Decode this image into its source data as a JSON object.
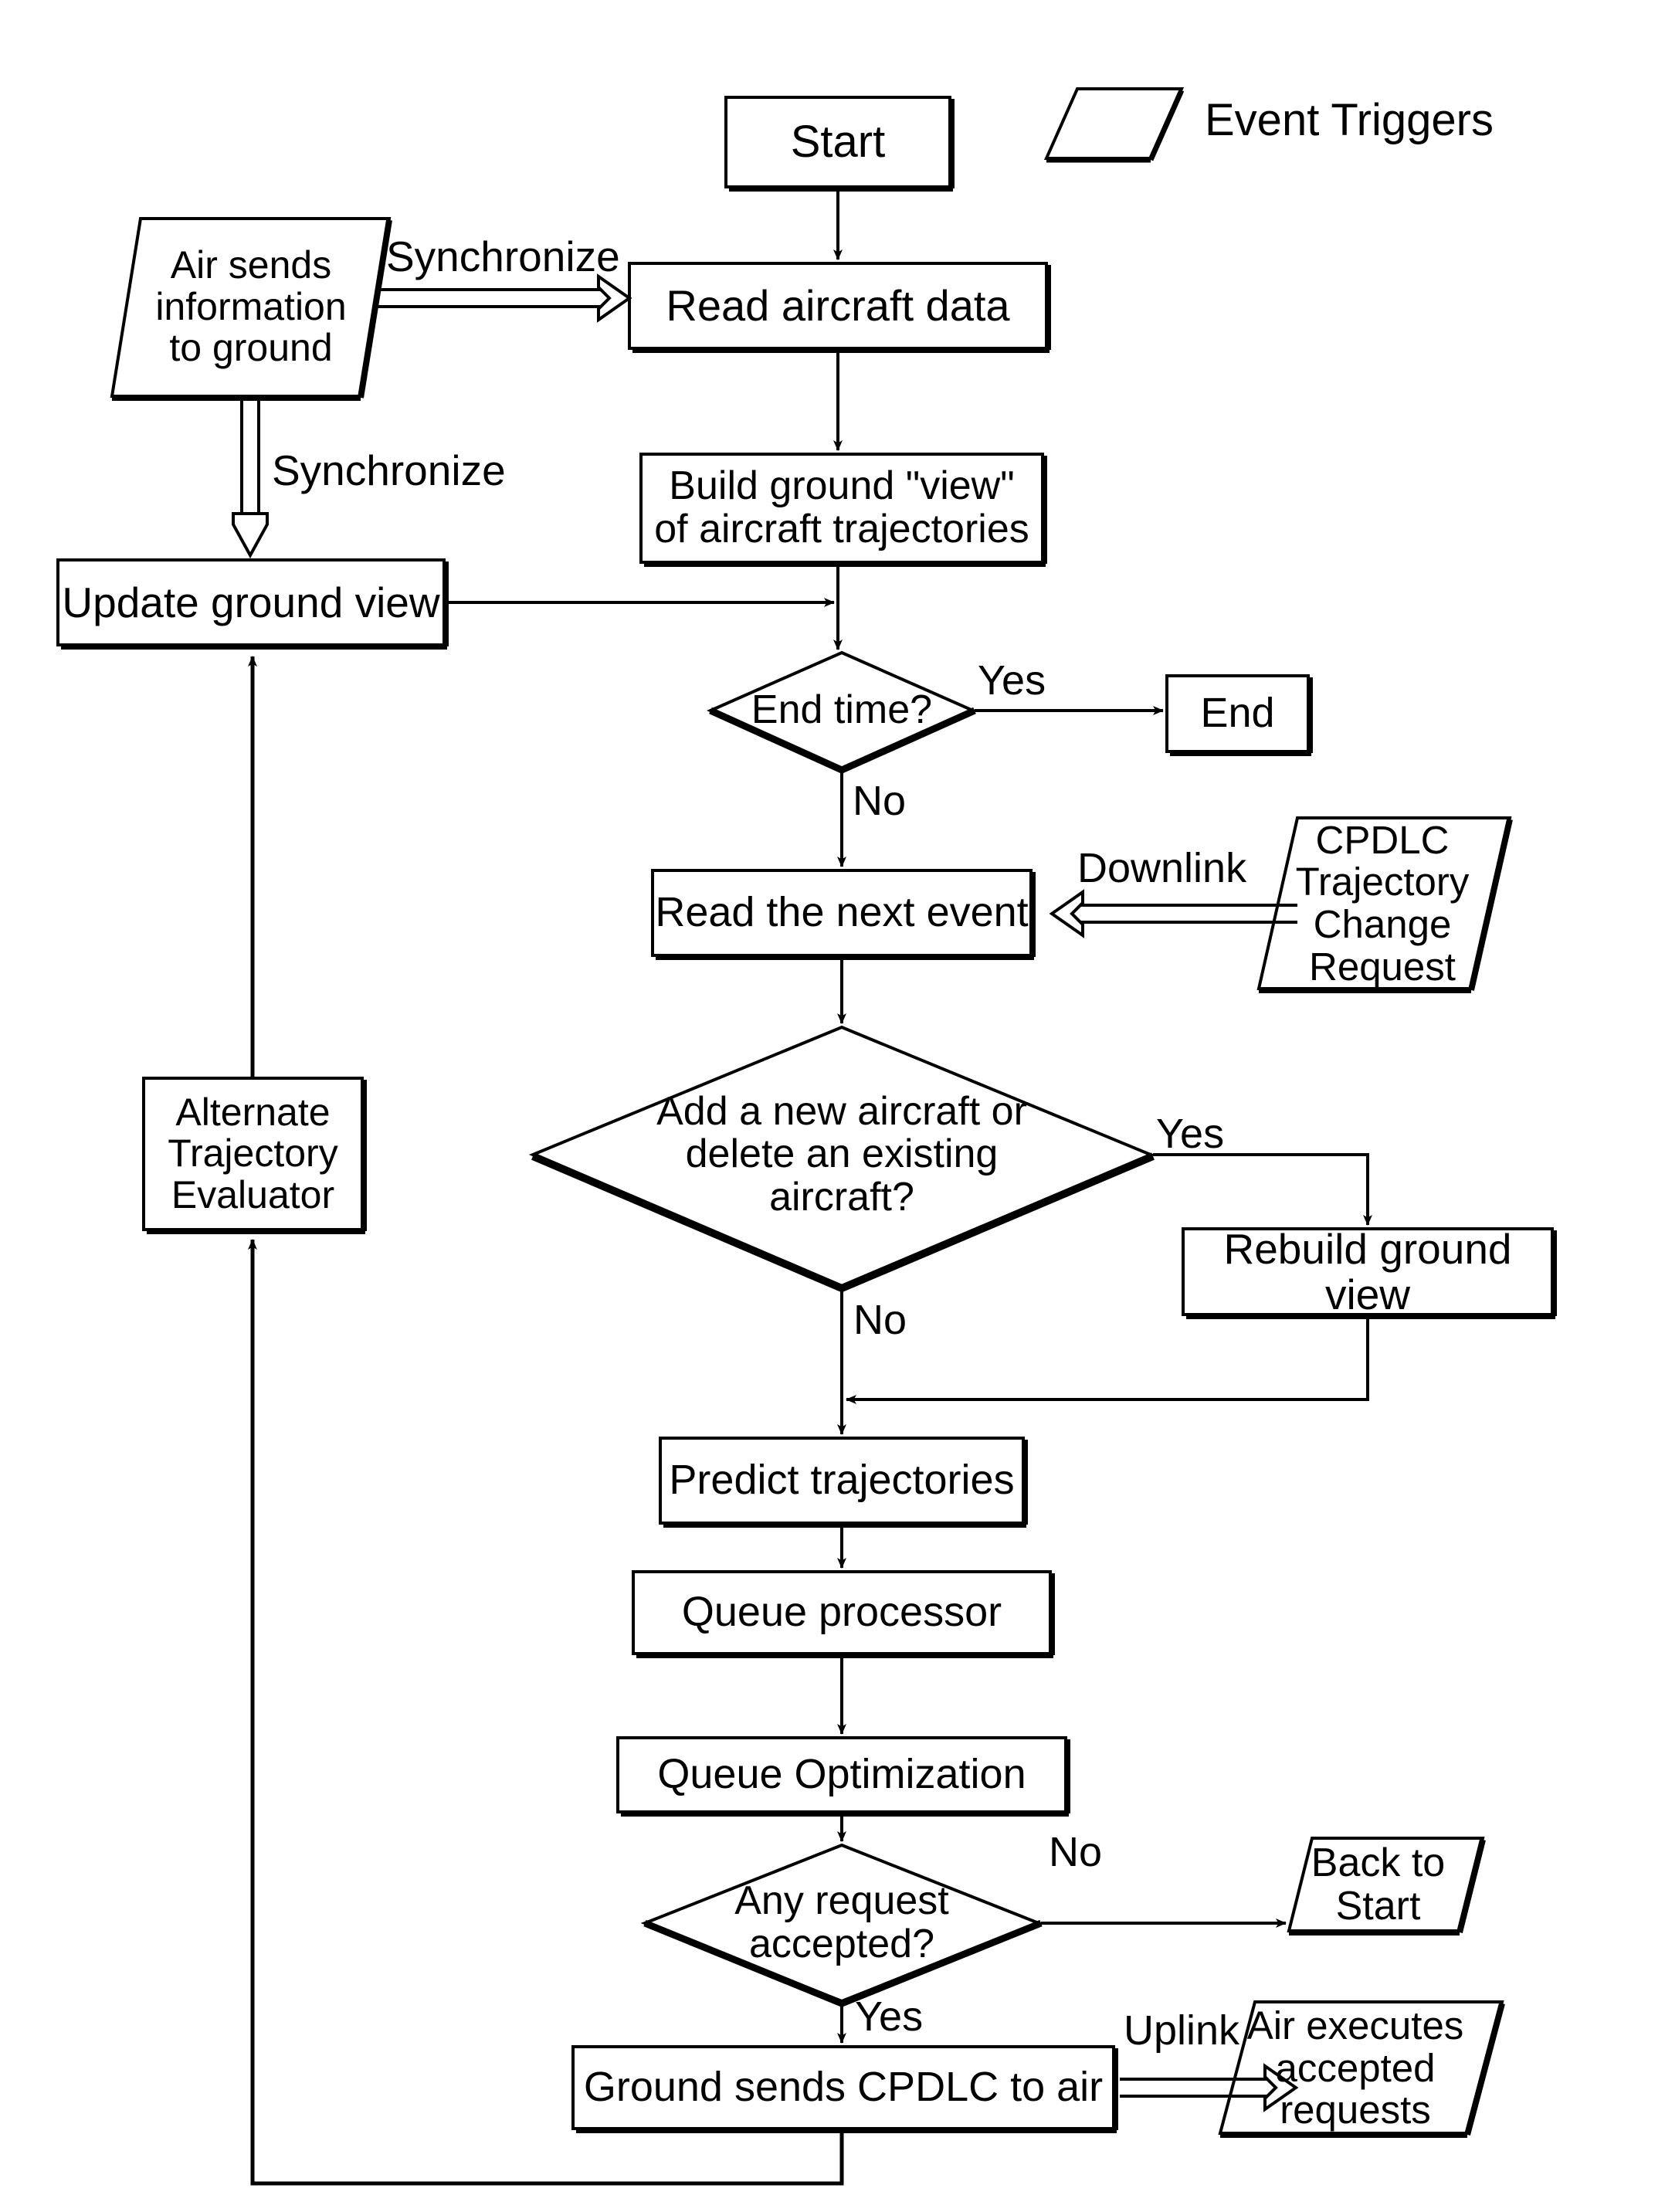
{
  "diagram": {
    "title": "Ground automation CPDLC trajectory processing flowchart",
    "legend": {
      "shape": "parallelogram",
      "label": "Event Triggers"
    },
    "colors": {
      "stroke": "#000000",
      "fill": "#ffffff",
      "text": "#000000"
    },
    "nodes": [
      {
        "id": "start",
        "shape": "process",
        "label": "Start"
      },
      {
        "id": "air_sends",
        "shape": "parallelogram",
        "label": "Air sends\ninformation\nto ground"
      },
      {
        "id": "read_data",
        "shape": "process",
        "label": "Read aircraft data"
      },
      {
        "id": "build_view",
        "shape": "process",
        "label": "Build ground \"view\"\nof aircraft trajectories"
      },
      {
        "id": "update_view",
        "shape": "process",
        "label": "Update ground view"
      },
      {
        "id": "end_time",
        "shape": "decision",
        "label": "End time?"
      },
      {
        "id": "end",
        "shape": "process",
        "label": "End"
      },
      {
        "id": "read_event",
        "shape": "process",
        "label": "Read the next event"
      },
      {
        "id": "cpdlc_req",
        "shape": "parallelogram",
        "label": "CPDLC\nTrajectory\nChange\nRequest"
      },
      {
        "id": "add_delete",
        "shape": "decision",
        "label": "Add a new aircraft or\ndelete an existing aircraft?"
      },
      {
        "id": "rebuild_view",
        "shape": "process",
        "label": "Rebuild ground view"
      },
      {
        "id": "alt_traj",
        "shape": "process",
        "label": "Alternate\nTrajectory\nEvaluator"
      },
      {
        "id": "predict",
        "shape": "process",
        "label": "Predict trajectories"
      },
      {
        "id": "queue_proc",
        "shape": "process",
        "label": "Queue processor"
      },
      {
        "id": "queue_opt",
        "shape": "process",
        "label": "Queue Optimization"
      },
      {
        "id": "any_req",
        "shape": "decision",
        "label": "Any request\naccepted?"
      },
      {
        "id": "back_start",
        "shape": "parallelogram",
        "label": "Back to\nStart"
      },
      {
        "id": "ground_sends",
        "shape": "process",
        "label": "Ground sends CPDLC to air"
      },
      {
        "id": "air_exec",
        "shape": "parallelogram",
        "label": "Air executes\naccepted\nrequests"
      }
    ],
    "edge_labels": [
      {
        "id": "sync_right",
        "text": "Synchronize"
      },
      {
        "id": "sync_down",
        "text": "Synchronize"
      },
      {
        "id": "yes_endtime",
        "text": "Yes"
      },
      {
        "id": "no_endtime",
        "text": "No"
      },
      {
        "id": "downlink",
        "text": "Downlink"
      },
      {
        "id": "yes_adddel",
        "text": "Yes"
      },
      {
        "id": "no_adddel",
        "text": "No"
      },
      {
        "id": "no_anyreq",
        "text": "No"
      },
      {
        "id": "yes_anyreq",
        "text": "Yes"
      },
      {
        "id": "uplink",
        "text": "Uplink"
      }
    ]
  }
}
